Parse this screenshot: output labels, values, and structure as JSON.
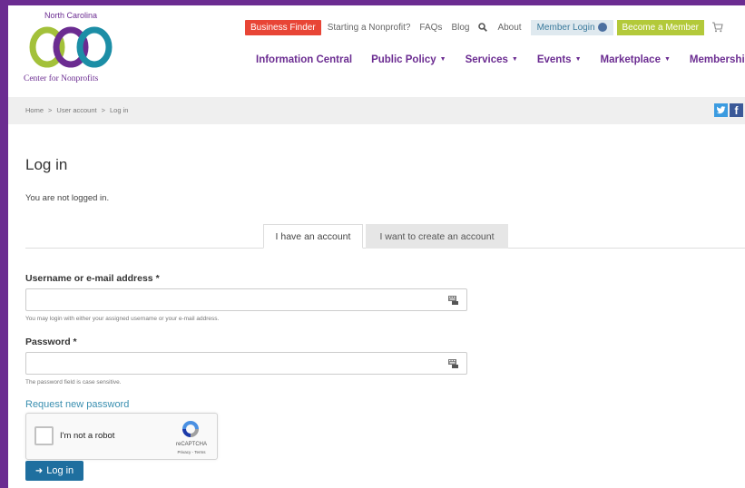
{
  "logo": {
    "top_text": "North Carolina",
    "bottom_text": "Center for Nonprofits",
    "colors": {
      "ring1": "#a3c13a",
      "ring2": "#6b2c91",
      "ring3": "#1c8ea6"
    }
  },
  "topnav": {
    "business_finder": "Business Finder",
    "starting": "Starting a Nonprofit?",
    "faqs": "FAQs",
    "blog": "Blog",
    "search_icon": "search-icon",
    "about": "About",
    "member_login": "Member Login",
    "become_member": "Become a Member",
    "cart_icon": "cart-icon"
  },
  "mainnav": {
    "items": [
      {
        "label": "Information Central",
        "caret": false
      },
      {
        "label": "Public Policy",
        "caret": true
      },
      {
        "label": "Services",
        "caret": true
      },
      {
        "label": "Events",
        "caret": true
      },
      {
        "label": "Marketplace",
        "caret": true
      },
      {
        "label": "Membership",
        "caret": true
      }
    ]
  },
  "breadcrumb": {
    "items": [
      "Home",
      "User account",
      "Log in"
    ],
    "separator": ">"
  },
  "social": {
    "twitter": "twitter-icon",
    "facebook": "facebook-icon"
  },
  "page": {
    "title": "Log in",
    "status": "You are not logged in."
  },
  "tabs": {
    "have_account": "I have an account",
    "create_account": "I want to create an account"
  },
  "form": {
    "username_label": "Username or e-mail address *",
    "username_value": "",
    "username_hint": "You may login with either your assigned username or your e-mail address.",
    "password_label": "Password *",
    "password_value": "",
    "password_hint": "The password field is case sensitive.",
    "request_password": "Request new password",
    "captcha_text": "I'm not a robot",
    "captcha_brand": "reCAPTCHA",
    "captcha_terms": "Privacy - Terms",
    "login_button": "Log in"
  },
  "colors": {
    "brand_purple": "#6b2c91",
    "finder_red": "#e84536",
    "member_green": "#b3c93a",
    "link_blue": "#3a8fb0",
    "button_blue": "#1f6f9f"
  }
}
